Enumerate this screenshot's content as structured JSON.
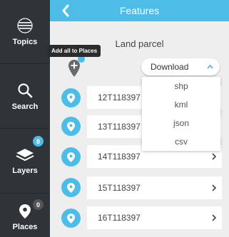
{
  "sidebar": {
    "items": [
      {
        "label": "Topics",
        "icon": "topics-icon"
      },
      {
        "label": "Search",
        "icon": "search-icon"
      },
      {
        "label": "Layers",
        "icon": "layers-icon",
        "badge": "8",
        "badge_color": "#4dbde8"
      },
      {
        "label": "Places",
        "icon": "pin-icon",
        "badge": "0",
        "badge_color": "#555555"
      }
    ]
  },
  "header": {
    "title": "Features",
    "back_icon": "chevron-left-icon"
  },
  "main": {
    "section_title": "Land parcel",
    "add_all_tooltip": "Add all to Places",
    "download": {
      "label": "Download",
      "options": [
        "shp",
        "kml",
        "json",
        "csv"
      ]
    },
    "rows": [
      {
        "label": "12T118397"
      },
      {
        "label": "13T118397"
      },
      {
        "label": "14T118397"
      },
      {
        "label": "15T118397"
      },
      {
        "label": "16T118397"
      }
    ]
  },
  "colors": {
    "accent": "#4dbde8",
    "sidebar_bg": "#2e3438",
    "content_bg": "#eeeeee"
  }
}
